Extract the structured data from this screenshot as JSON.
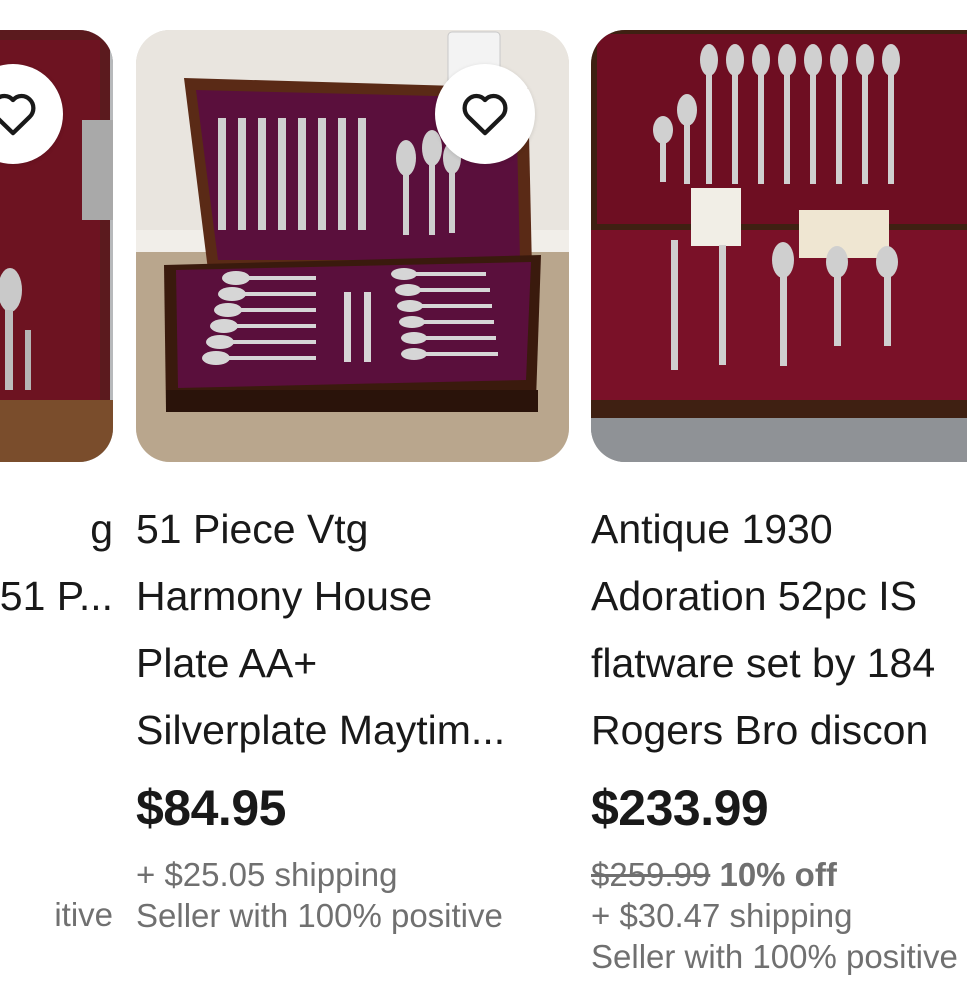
{
  "cards": [
    {
      "title_lines": [
        "",
        "g",
        "",
        "51 P..."
      ],
      "price": "",
      "original_price": "",
      "discount": "",
      "shipping": "",
      "seller": "itive",
      "favorite_icon": "heart-outline-icon"
    },
    {
      "title_lines": [
        "51 Piece Vtg",
        "Harmony House",
        "Plate AA+",
        "Silverplate Maytim..."
      ],
      "price": "$84.95",
      "original_price": "",
      "discount": "",
      "shipping": "+ $25.05 shipping",
      "seller": "Seller with 100% positive",
      "favorite_icon": "heart-outline-icon"
    },
    {
      "title_lines": [
        "Antique 1930",
        "Adoration 52pc IS",
        "flatware set by 184",
        "Rogers Bro discon"
      ],
      "price": "$233.99",
      "original_price": "$259.99",
      "discount": "10% off",
      "shipping": "+ $30.47 shipping",
      "seller": "Seller with 100% positive",
      "favorite_icon": "heart-outline-icon"
    }
  ],
  "colors": {
    "text": "#191919",
    "muted": "#707070",
    "velvet_purple": "#5a0f3c",
    "velvet_red": "#7a1128",
    "wood": "#4a2314"
  }
}
